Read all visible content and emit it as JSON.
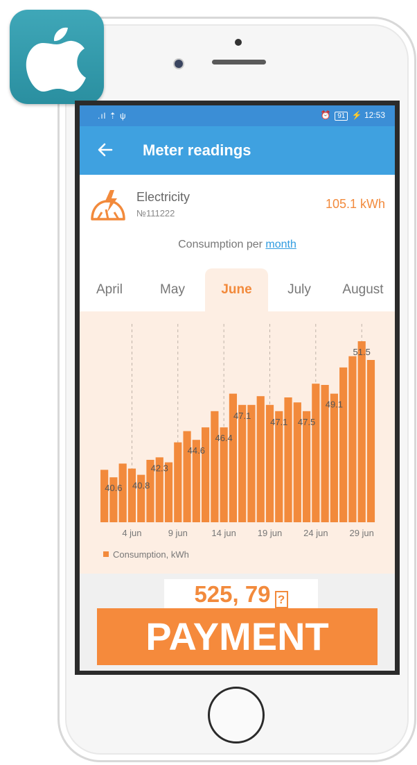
{
  "status_bar": {
    "left_icons": ".ıl ⇡ ψ",
    "battery": "91",
    "time": "12:53"
  },
  "app_bar": {
    "title": "Meter readings",
    "back_icon": "arrow-left-icon"
  },
  "meter": {
    "icon": "meter-lightning-icon",
    "name": "Electricity",
    "number": "№111222",
    "value": "105.1 kWh"
  },
  "consumption": {
    "prefix": "Consumption per ",
    "link": "month"
  },
  "tabs": [
    {
      "label": "April",
      "active": false
    },
    {
      "label": "May",
      "active": false
    },
    {
      "label": "June",
      "active": true
    },
    {
      "label": "July",
      "active": false
    },
    {
      "label": "August",
      "active": false
    }
  ],
  "colors": {
    "accent": "#f28a3c",
    "primary": "#3fa1e0",
    "chart_bg": "#fdeee3"
  },
  "chart_data": {
    "type": "bar",
    "title": "",
    "xlabel": "",
    "ylabel": "",
    "categories": [
      "1",
      "2",
      "3",
      "4",
      "5",
      "6",
      "7",
      "8",
      "9",
      "10",
      "11",
      "12",
      "13",
      "14",
      "15",
      "16",
      "17",
      "18",
      "19",
      "20",
      "21",
      "22",
      "23",
      "24",
      "25",
      "26",
      "27",
      "28",
      "29",
      "30"
    ],
    "series": [
      {
        "name": "Consumption, kWh",
        "values": [
          41.2,
          40.6,
          41.7,
          41.3,
          40.8,
          42.0,
          42.2,
          41.8,
          43.4,
          44.3,
          43.6,
          44.6,
          45.9,
          44.6,
          47.3,
          46.4,
          46.4,
          47.1,
          46.4,
          45.9,
          47.0,
          46.6,
          45.9,
          48.1,
          48.0,
          47.3,
          49.4,
          50.3,
          51.5,
          50.0
        ]
      }
    ],
    "data_labels": [
      {
        "index": 1,
        "text": "40.6"
      },
      {
        "index": 4,
        "text": "40.8"
      },
      {
        "index": 6,
        "text": "42.3"
      },
      {
        "index": 10,
        "text": "44.6"
      },
      {
        "index": 13,
        "text": "46.4"
      },
      {
        "index": 15,
        "text": "47.1"
      },
      {
        "index": 19,
        "text": "47.1"
      },
      {
        "index": 22,
        "text": "47.5"
      },
      {
        "index": 25,
        "text": "49.1"
      },
      {
        "index": 28,
        "text": "51.5"
      }
    ],
    "x_ticks": [
      {
        "index": 3,
        "label": "4 jun"
      },
      {
        "index": 8,
        "label": "9 jun"
      },
      {
        "index": 13,
        "label": "14 jun"
      },
      {
        "index": 18,
        "label": "19 jun"
      },
      {
        "index": 23,
        "label": "24 jun"
      },
      {
        "index": 28,
        "label": "29 jun"
      }
    ],
    "ylim": [
      37,
      52.5
    ],
    "grid": "dashed vertical at ticks",
    "legend": "bottom-left",
    "legend_label": "Consumption, kWh"
  },
  "payment": {
    "amount": "525, 79",
    "currency_glyph": "?",
    "button_label": "PAYMENT"
  },
  "app_icon": "apple-logo-icon"
}
